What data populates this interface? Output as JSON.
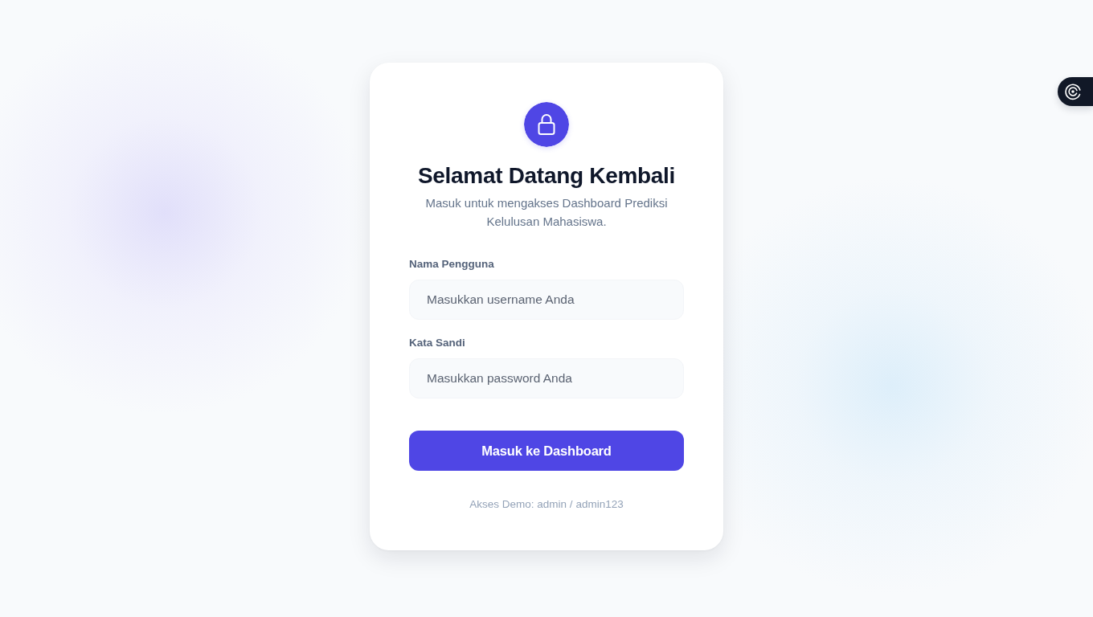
{
  "login_card": {
    "title": "Selamat Datang Kembali",
    "subtitle": "Masuk untuk mengakses Dashboard Prediksi Kelulusan Mahasiswa.",
    "fields": [
      {
        "label": "Nama Pengguna",
        "placeholder": "Masukkan username Anda"
      },
      {
        "label": "Kata Sandi",
        "placeholder": "Masukkan password Anda"
      }
    ],
    "submit_button": "Masuk ke Dashboard",
    "demo_note": "Akses Demo: admin / admin123"
  }
}
